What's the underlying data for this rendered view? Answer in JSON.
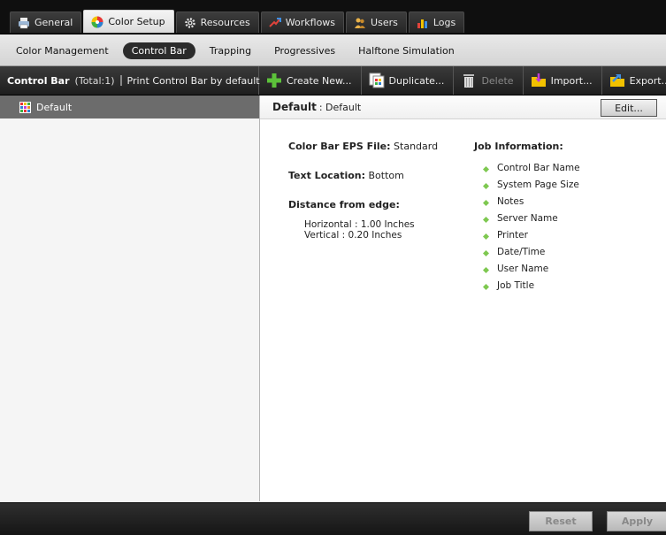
{
  "top_tabs": [
    {
      "label": "General",
      "icon": "printer-icon",
      "active": false
    },
    {
      "label": "Color Setup",
      "icon": "color-wheel-icon",
      "active": true
    },
    {
      "label": "Resources",
      "icon": "gear-icon",
      "active": false
    },
    {
      "label": "Workflows",
      "icon": "workflow-arrows-icon",
      "active": false
    },
    {
      "label": "Users",
      "icon": "users-icon",
      "active": false
    },
    {
      "label": "Logs",
      "icon": "bar-chart-icon",
      "active": false
    }
  ],
  "sub_tabs": [
    {
      "label": "Color Management",
      "active": false
    },
    {
      "label": "Control Bar",
      "active": true
    },
    {
      "label": "Trapping",
      "active": false
    },
    {
      "label": "Progressives",
      "active": false
    },
    {
      "label": "Halftone Simulation",
      "active": false
    }
  ],
  "toolbar": {
    "title": "Control Bar",
    "total": "(Total:1)",
    "print_default_label": "Print Control Bar by default",
    "create_new": "Create New...",
    "duplicate": "Duplicate...",
    "delete": "Delete",
    "import": "Import...",
    "export": "Export..."
  },
  "list": {
    "items": [
      {
        "label": "Default",
        "selected": true
      }
    ]
  },
  "detail": {
    "header_bold": "Default",
    "header_rest": ": Default",
    "edit_label": "Edit...",
    "eps_label": "Color Bar EPS File:",
    "eps_value": "Standard",
    "text_location_label": "Text Location:",
    "text_location_value": "Bottom",
    "distance_label": "Distance from edge:",
    "horizontal": "Horizontal : 1.00 Inches",
    "vertical": "Vertical : 0.20 Inches",
    "job_info_label": "Job Information:",
    "job_info_items": [
      "Control Bar Name",
      "System Page Size",
      "Notes",
      "Server Name",
      "Printer",
      "Date/Time",
      "User Name",
      "Job Title"
    ]
  },
  "footer": {
    "reset": "Reset",
    "apply": "Apply"
  },
  "colors": {
    "bullet": "#7ec850",
    "selected_row": "#6c6c6c",
    "active_subtab": "#2b2b2b"
  }
}
